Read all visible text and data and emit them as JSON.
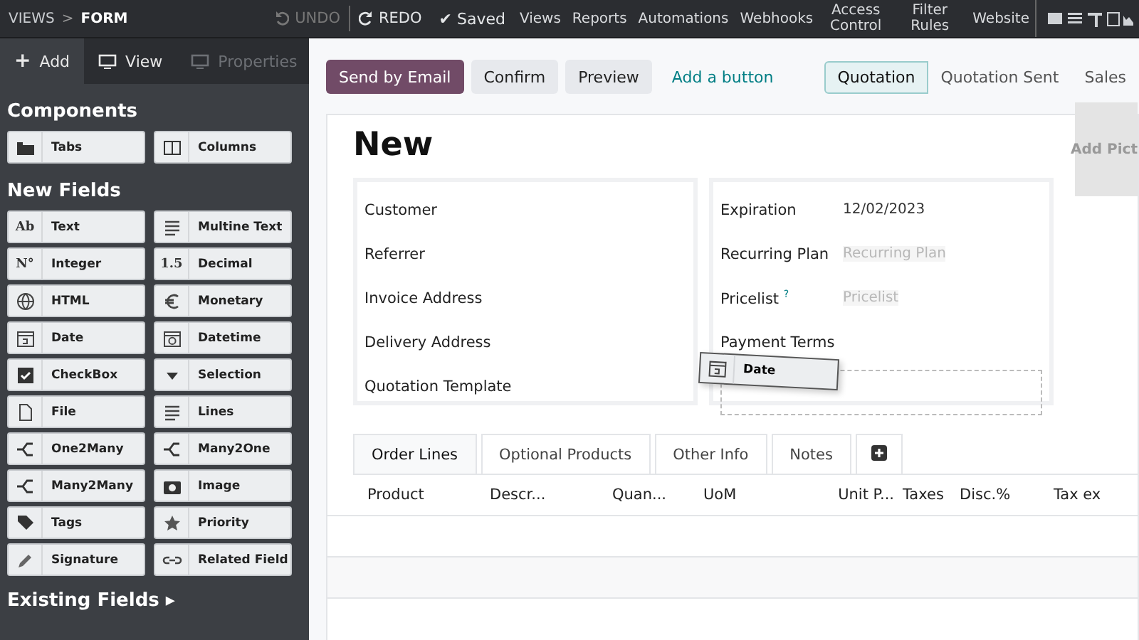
{
  "breadcrumb": {
    "parent": "VIEWS",
    "separator": ">",
    "current": "FORM"
  },
  "history": [
    {
      "label": "UNDO",
      "disabled": true
    },
    {
      "label": "REDO",
      "disabled": false
    }
  ],
  "save_state": "✔ Saved",
  "menu": [
    "Views",
    "Reports",
    "Automations",
    "Webhooks",
    "Access Control",
    "Filter Rules",
    "Website"
  ],
  "sidebar": {
    "tabs": [
      {
        "label": "Add",
        "glyph": "+",
        "selected": true,
        "disabled": false
      },
      {
        "label": "View",
        "selected": false,
        "disabled": false
      },
      {
        "label": "Properties",
        "selected": false,
        "disabled": true
      }
    ],
    "components_title": "Components",
    "components": [
      {
        "label": "Tabs"
      },
      {
        "label": "Columns"
      }
    ],
    "new_fields_title": "New Fields",
    "new_fields": [
      {
        "label": "Text",
        "glyph": "Ab"
      },
      {
        "label": "Multine Text"
      },
      {
        "label": "Integer",
        "glyph": "N°"
      },
      {
        "label": "Decimal",
        "glyph": "1.5"
      },
      {
        "label": "HTML"
      },
      {
        "label": "Monetary"
      },
      {
        "label": "Date"
      },
      {
        "label": "Datetime"
      },
      {
        "label": "CheckBox"
      },
      {
        "label": "Selection"
      },
      {
        "label": "File"
      },
      {
        "label": "Lines"
      },
      {
        "label": "One2Many"
      },
      {
        "label": "Many2One"
      },
      {
        "label": "Many2Many"
      },
      {
        "label": "Image"
      },
      {
        "label": "Tags"
      },
      {
        "label": "Priority"
      },
      {
        "label": "Signature"
      },
      {
        "label": "Related Field"
      }
    ],
    "existing_fields_title": "Existing Fields",
    "existing_fields_caret": "▸"
  },
  "action_buttons": [
    {
      "label": "Send by Email",
      "kind": "primary"
    },
    {
      "label": "Confirm",
      "kind": "secondary"
    },
    {
      "label": "Preview",
      "kind": "secondary"
    },
    {
      "label": "Add a button",
      "kind": "link"
    }
  ],
  "status_bar": [
    {
      "label": "Quotation",
      "selected": true
    },
    {
      "label": "Quotation Sent",
      "selected": false
    },
    {
      "label": "Sales",
      "selected": false
    }
  ],
  "form": {
    "title": "New",
    "left_fields": [
      "Customer",
      "Referrer",
      "Invoice Address",
      "Delivery Address",
      "Quotation Template"
    ],
    "right_fields": [
      {
        "label": "Expiration",
        "value": "12/02/2023"
      },
      {
        "label": "Recurring Plan",
        "placeholder": "Recurring Plan"
      },
      {
        "label": "Pricelist $^{?}$",
        "placeholder": "Pricelist"
      },
      {
        "label": "Payment Terms"
      }
    ],
    "dragged_field": "Date",
    "picture_button": "Add Pict"
  },
  "notebook_tabs": [
    {
      "label": "Order Lines",
      "selected": true
    },
    {
      "label": "Optional Products",
      "selected": false
    },
    {
      "label": "Other Info",
      "selected": false
    },
    {
      "label": "Notes",
      "selected": false
    }
  ],
  "table": {
    "columns": [
      "Product",
      "Descr...",
      "Quan...",
      "UoM",
      "Unit P...",
      "Taxes",
      "Disc.%",
      "Tax ex"
    ]
  }
}
